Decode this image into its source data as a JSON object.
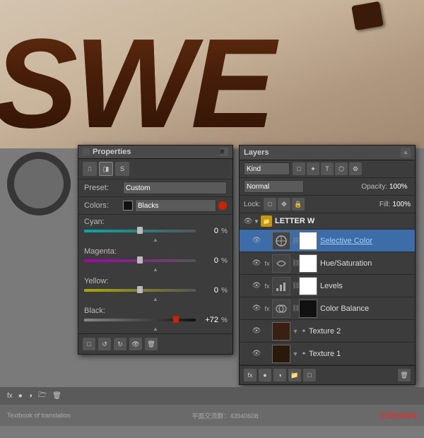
{
  "background": {
    "letters_text": "SWE",
    "bottom_color": "#7a7a7a"
  },
  "properties_panel": {
    "title": "Properties",
    "icon_label": "S",
    "preset_label": "Preset:",
    "preset_value": "Custom",
    "colors_label": "Colors:",
    "colors_value": "Blacks",
    "cyan_label": "Cyan:",
    "cyan_value": "0",
    "cyan_unit": "%",
    "magenta_label": "Magenta:",
    "magenta_value": "0",
    "magenta_unit": "%",
    "yellow_label": "Yellow:",
    "yellow_value": "0",
    "yellow_unit": "%",
    "black_label": "Black:",
    "black_value": "+72",
    "black_unit": "%",
    "bottom_icons": [
      "□",
      "↺",
      "↻",
      "👁",
      "🗑"
    ]
  },
  "layers_panel": {
    "title": "Layers",
    "kind_label": "Kind",
    "blend_mode": "Normal",
    "opacity_label": "Opacity:",
    "opacity_value": "100%",
    "lock_label": "Lock:",
    "fill_label": "Fill:",
    "fill_value": "100%",
    "group_name": "LETTER W",
    "layers": [
      {
        "name": "Selective Color",
        "type": "adjustment",
        "selected": true,
        "visible": true,
        "adj_icon": "SC"
      },
      {
        "name": "Hue/Saturation",
        "type": "adjustment",
        "selected": false,
        "visible": true,
        "adj_icon": "HS"
      },
      {
        "name": "Levels",
        "type": "adjustment",
        "selected": false,
        "visible": true,
        "adj_icon": "LV"
      },
      {
        "name": "Color Balance",
        "type": "adjustment",
        "selected": false,
        "visible": true,
        "adj_icon": "CB"
      },
      {
        "name": "Texture 2",
        "type": "normal",
        "selected": false,
        "visible": true
      },
      {
        "name": "Texture 1",
        "type": "normal",
        "selected": false,
        "visible": true
      }
    ],
    "bottom_icons": [
      "fx",
      "●",
      "□",
      "🗁",
      "🗑"
    ]
  },
  "watermark": {
    "text_left": "Textbook of translation",
    "group_label": "平面交流群：43940608",
    "brand": "三DESIGN"
  }
}
